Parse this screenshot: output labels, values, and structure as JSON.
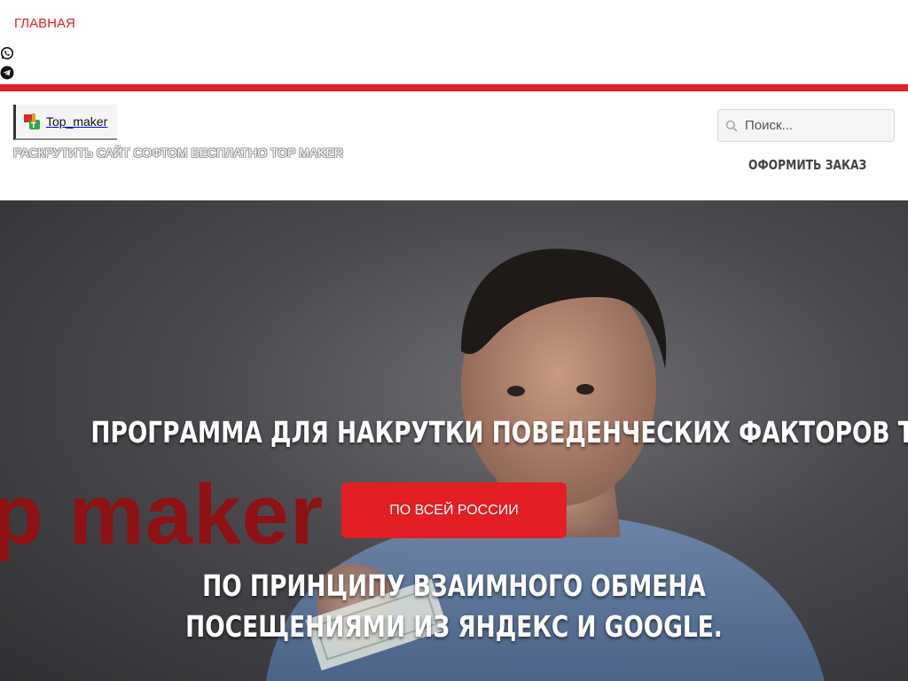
{
  "topnav": {
    "home_label": "ГЛАВНАЯ",
    "social": [
      "whatsapp-icon",
      "telegram-icon"
    ]
  },
  "header": {
    "logo_text": "Top_maker",
    "tagline": "РАСКРУТИТЬ САЙТ СОФТОМ БЕСПЛАТНО TOP MAKER",
    "search_placeholder": "Поиск...",
    "order_label": "ОФОРМИТЬ ЗАКАЗ"
  },
  "hero": {
    "brand_overlay": "p maker",
    "title": "ПРОГРАММА ДЛЯ НАКРУТКИ ПОВЕДЕНЧЕСКИХ ФАКТОРОВ TOP MAKER",
    "button_label": "ПО ВСЕЙ РОССИИ",
    "subtitle": "ПО ПРИНЦИПУ ВЗАИМНОГО ОБМЕНА ПОСЕЩЕНИЯМИ ИЗ ЯНДЕКС И GOOGLE."
  },
  "colors": {
    "accent": "#e31e24",
    "brand_dark_red": "#8e1114",
    "text_dark": "#444444"
  }
}
